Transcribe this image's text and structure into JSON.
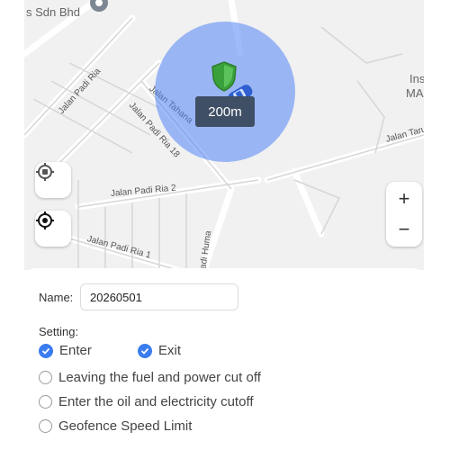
{
  "map": {
    "poi_top": "s Sdn Bhd",
    "poi_right_1": "Ins",
    "poi_right_2": "MA",
    "streets": [
      "Jalan Padi Ria",
      "Jalan Tahana",
      "Jalan Padi Ria 18",
      "Jalan Taru",
      "Jalan Padi Ria 2",
      "Jalan Padi Ria 1",
      "Padi Huma"
    ],
    "radius_label": "200m",
    "zoom_in": "+",
    "zoom_out": "−",
    "geofence_color": "#5284f6"
  },
  "form": {
    "name_label": "Name:",
    "name_value": "20260501",
    "setting_label": "Setting:",
    "options": [
      {
        "label": "Enter",
        "checked": true
      },
      {
        "label": "Exit",
        "checked": true
      },
      {
        "label": "Leaving the fuel and power cut off",
        "checked": false
      },
      {
        "label": "Enter the oil and electricity cutoff",
        "checked": false
      },
      {
        "label": "Geofence Speed Limit",
        "checked": false
      }
    ],
    "accent_color": "#3b7cf0"
  }
}
